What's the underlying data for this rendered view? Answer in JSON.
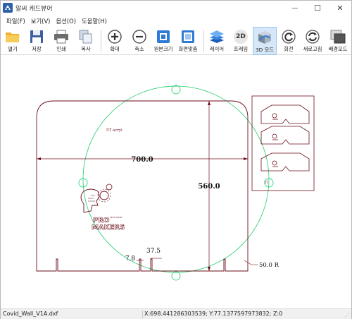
{
  "window": {
    "title": "알씨 캐드뷰어",
    "minimize_glyph": "—",
    "maximize_glyph": "☐",
    "close_glyph": "✕"
  },
  "menu": [
    "파일(F)",
    "보기(V)",
    "옵션(O)",
    "도움말(H)"
  ],
  "toolbar": {
    "open": "열기",
    "save": "저장",
    "print": "인쇄",
    "copy": "복사",
    "zoom_in": "확대",
    "zoom_out": "축소",
    "original_size": "원본크기",
    "fit_screen": "화면맞춤",
    "layer": "레이어",
    "frame": "프레임",
    "mode_3d": "3D 모드",
    "rotate": "회전",
    "refresh": "새로고침",
    "background": "배경모드",
    "frame_icon_text": "2D"
  },
  "drawing": {
    "dim_width": "700.0",
    "dim_height": "560.0",
    "dim_slot": "37.5",
    "dim_small": "7.8",
    "radius_label": "50.0 R",
    "note_text": "5T acryl",
    "logo_line1": "PRO",
    "logo_line2": "MAKERS",
    "logo_tag": "TECH SHOP",
    "inset_label": "5T",
    "colors": {
      "outline": "#6b0d1a",
      "circle": "#36d17c",
      "background": "#ffffff"
    }
  },
  "status": {
    "file": "Covid_Wall_V1A.dxf",
    "coords": "X:698.441286303539; Y:77.1377597973832; Z:0"
  }
}
